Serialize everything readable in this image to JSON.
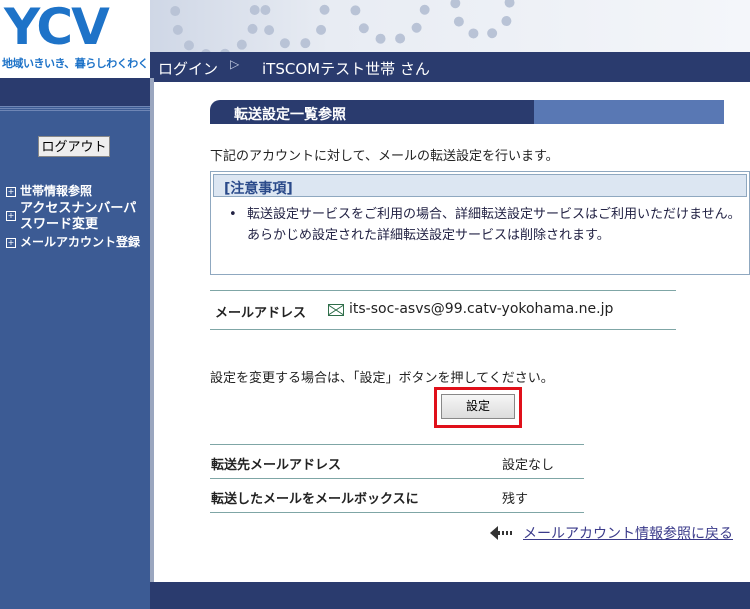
{
  "brand": {
    "logo_text": "YCV",
    "tagline": "地域いきいき、暮らしわくわく",
    "brand_color": "#1e73c8"
  },
  "header": {
    "login_label": "ログイン",
    "separator": "▷",
    "user_label": "iTSCOMテスト世帯 さん",
    "bar_color": "#2a3b6e"
  },
  "sidebar": {
    "logout_label": "ログアウト",
    "items": [
      {
        "label": "世帯情報参照"
      },
      {
        "label": "アクセスナンバーパスワード変更"
      },
      {
        "label": "メールアカウント登録"
      }
    ],
    "color": "#3c5b94"
  },
  "main": {
    "section_title": "転送設定一覧参照",
    "intro": "下記のアカウントに対して、メールの転送設定を行います。",
    "notice": {
      "heading": "[注意事項]",
      "bullet": "•",
      "text": "転送設定サービスをご利用の場合、詳細転送設定サービスはご利用いただけません。あらかじめ設定された詳細転送設定サービスは削除されます。"
    },
    "mail": {
      "label": "メールアドレス",
      "icon": "envelope-icon",
      "value": "its-soc-asvs@99.catv-yokohama.ne.jp"
    },
    "change_message": "設定を変更する場合は、「設定」ボタンを押してください。",
    "set_button_label": "設定",
    "highlight_color": "#e0101a",
    "table": [
      {
        "label": "転送先メールアドレス",
        "value": "設定なし"
      },
      {
        "label": "転送したメールをメールボックスに",
        "value": "残す"
      }
    ],
    "back_link": {
      "icon": "back-arrow-icon",
      "label": "メールアカウント情報参照に戻る"
    }
  }
}
